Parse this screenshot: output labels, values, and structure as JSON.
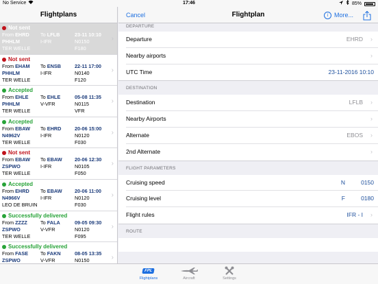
{
  "statusbar": {
    "carrier": "No Service",
    "time": "17:46",
    "battery": "85%"
  },
  "left": {
    "title": "Flightplans",
    "items": [
      {
        "status": "Not sent",
        "status_color": "red",
        "from_label": "From",
        "from": "EHRD",
        "to_label": "To",
        "to": "LFLB",
        "datetime": "23-11 10:10",
        "reg": "PHHLM",
        "rules": "I-IFR",
        "speed": "N0150",
        "pilot": "TER WELLE",
        "level": "F180",
        "selected": true
      },
      {
        "status": "Not sent",
        "status_color": "red",
        "from_label": "From",
        "from": "EHAM",
        "to_label": "To",
        "to": "ENSB",
        "datetime": "22-11 17:00",
        "reg": "PHHLM",
        "rules": "I-IFR",
        "speed": "N0140",
        "pilot": "TER WELLE",
        "level": "F120"
      },
      {
        "status": "Accepted",
        "status_color": "green",
        "from_label": "From",
        "from": "EHLE",
        "to_label": "To",
        "to": "EHLE",
        "datetime": "05-08 11:35",
        "reg": "PHHLM",
        "rules": "V-VFR",
        "speed": "N0115",
        "pilot": "TER WELLE",
        "level": "VFR"
      },
      {
        "status": "Accepted",
        "status_color": "green",
        "from_label": "From",
        "from": "EBAW",
        "to_label": "To",
        "to": "EHRD",
        "datetime": "20-06 15:00",
        "reg": "N4962V",
        "rules": "I-IFR",
        "speed": "N0120",
        "pilot": "TER WELLE",
        "level": "F030"
      },
      {
        "status": "Not sent",
        "status_color": "red",
        "from_label": "From",
        "from": "EBAW",
        "to_label": "To",
        "to": "EBAW",
        "datetime": "20-06 12:30",
        "reg": "ZSPWO",
        "rules": "I-IFR",
        "speed": "N0105",
        "pilot": "TER WELLE",
        "level": "F050"
      },
      {
        "status": "Accepted",
        "status_color": "green",
        "from_label": "From",
        "from": "EHRD",
        "to_label": "To",
        "to": "EBAW",
        "datetime": "20-06 11:00",
        "reg": "N4966V",
        "rules": "I-IFR",
        "speed": "N0120",
        "pilot": "LEO DE BRUIN",
        "level": "F030"
      },
      {
        "status": "Successfully delivered",
        "status_color": "green",
        "from_label": "From",
        "from": "ZZZZ",
        "to_label": "To",
        "to": "FALA",
        "datetime": "09-05 09:30",
        "reg": "ZSPWO",
        "rules": "V-VFR",
        "speed": "N0120",
        "pilot": "TER WELLE",
        "level": "F095"
      },
      {
        "status": "Successfully delivered",
        "status_color": "green",
        "from_label": "From",
        "from": "FASE",
        "to_label": "To",
        "to": "FAKN",
        "datetime": "08-05 13:35",
        "reg": "ZSPWO",
        "rules": "V-VFR",
        "speed": "N0150",
        "pilot": "",
        "level": ""
      }
    ]
  },
  "nav": {
    "cancel": "Cancel",
    "title": "Flightplan",
    "more": "More...",
    "info_icon": "info-icon",
    "share_icon": "share-icon"
  },
  "form": {
    "departure_header": "DEPARTURE",
    "departure_label": "Departure",
    "departure_value": "EHRD",
    "nearby_label": "Nearby airports",
    "utc_label": "UTC Time",
    "utc_value": "23-11-2016 10:10",
    "destination_header": "DESTINATION",
    "destination_label": "Destination",
    "destination_value": "LFLB",
    "nearby2_label": "Nearby Airports",
    "alternate_label": "Alternate",
    "alternate_value": "EBOS",
    "alt2_label": "2nd Alternate",
    "params_header": "FLIGHT PARAMETERS",
    "speed_label": "Cruising speed",
    "speed_unit": "N",
    "speed_value": "0150",
    "level_label": "Cruising level",
    "level_unit": "F",
    "level_value": "0180",
    "rules_label": "Flight rules",
    "rules_value": "IFR - I",
    "route_header": "ROUTE"
  },
  "tabs": [
    {
      "label": "Flightplans",
      "icon": "fpl-logo-icon",
      "logo_text": "FPL",
      "active": true
    },
    {
      "label": "Aircraft",
      "icon": "airplane-icon"
    },
    {
      "label": "Settings",
      "icon": "tools-icon"
    }
  ]
}
